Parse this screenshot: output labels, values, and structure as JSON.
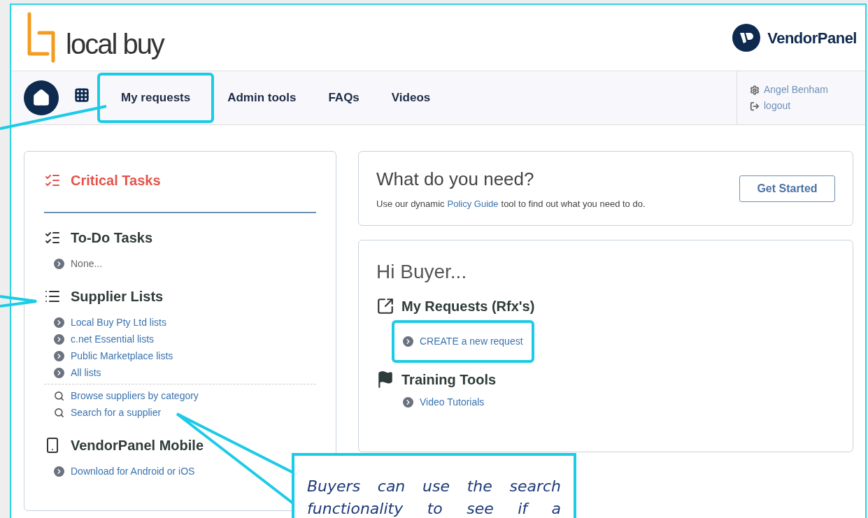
{
  "header": {
    "logo_text": "local buy",
    "brand_text": "VendorPanel"
  },
  "nav": {
    "tabs": [
      {
        "label": "My requests",
        "highlighted": true
      },
      {
        "label": "Admin tools",
        "highlighted": false
      },
      {
        "label": "FAQs",
        "highlighted": false
      },
      {
        "label": "Videos",
        "highlighted": false
      }
    ],
    "user": "Angel Benham",
    "logout": "logout"
  },
  "sidebar": {
    "sections": [
      {
        "kind": "critical",
        "title": "Critical Tasks"
      },
      {
        "kind": "todo",
        "title": "To-Do Tasks",
        "items": [
          {
            "kind": "note",
            "label": "None..."
          }
        ]
      },
      {
        "kind": "list",
        "title": "Supplier Lists",
        "items": [
          {
            "kind": "link",
            "label": "Local Buy Pty Ltd lists"
          },
          {
            "kind": "link",
            "label": "c.net Essential lists"
          },
          {
            "kind": "link",
            "label": "Public Marketplace lists"
          },
          {
            "kind": "link",
            "label": "All lists"
          },
          {
            "kind": "divider"
          },
          {
            "kind": "search",
            "label": "Browse suppliers by category"
          },
          {
            "kind": "search",
            "label": "Search for a supplier"
          }
        ]
      },
      {
        "kind": "mobile",
        "title": "VendorPanel Mobile",
        "items": [
          {
            "kind": "link",
            "label": "Download for Android or iOS"
          }
        ]
      }
    ]
  },
  "need_card": {
    "title": "What do you need?",
    "text_before": "Use our dynamic",
    "link": "Policy Guide",
    "text_after": "tool to find out what you need to do.",
    "button": "Get Started"
  },
  "welcome_card": {
    "greeting": "Hi Buyer...",
    "sections": [
      {
        "kind": "external",
        "title": "My Requests (Rfx's)",
        "links": [
          {
            "label": "CREATE a new request",
            "highlighted": true
          }
        ]
      },
      {
        "kind": "flag",
        "title": "Training Tools",
        "links": [
          {
            "label": "Video Tutorials",
            "highlighted": false
          }
        ]
      }
    ]
  },
  "callout": {
    "text": "Buyers can use the search functionality to see if a"
  }
}
